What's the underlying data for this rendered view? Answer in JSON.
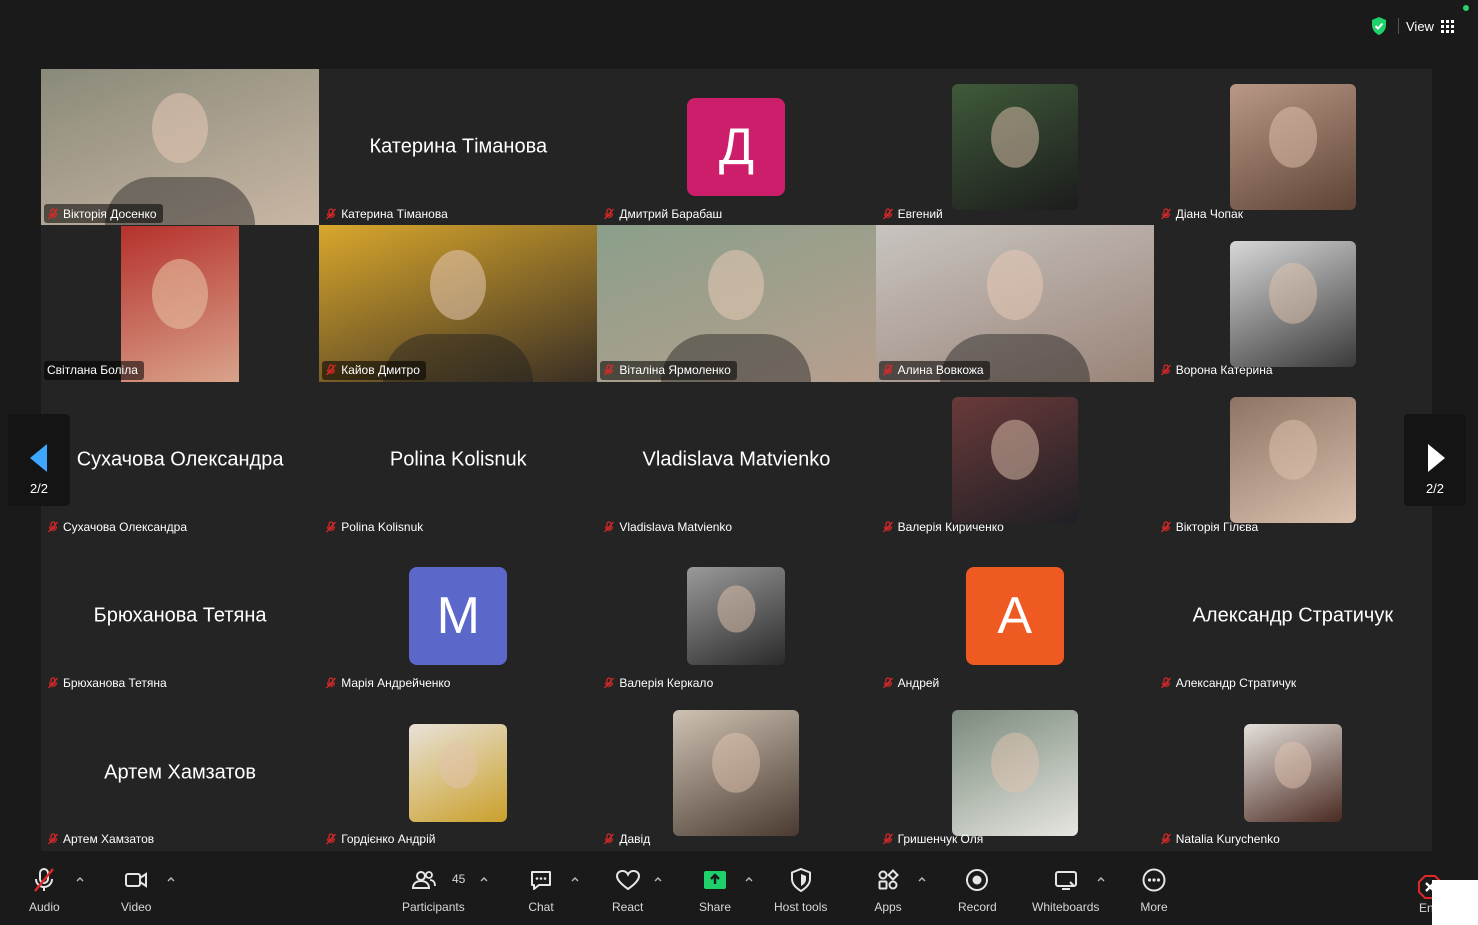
{
  "header": {
    "view_label": "View"
  },
  "gallery": {
    "tiles": [
      {
        "name": "Вікторія Досенко",
        "kind": "video",
        "c1": "#8a8a7a",
        "c2": "#c9b6a4",
        "muted": true
      },
      {
        "name": "Катерина Тіманова",
        "kind": "name",
        "display": "Катерина Тіманова",
        "muted": true
      },
      {
        "name": "Дмитрий Барабаш",
        "kind": "avatar",
        "letter": "Д",
        "color": "#cc1e6a",
        "muted": true
      },
      {
        "name": "Евгений",
        "kind": "photo",
        "c1": "#3f5a3a",
        "c2": "#1c1c1c",
        "muted": true
      },
      {
        "name": "Діана Чопак",
        "kind": "photo",
        "c1": "#b99886",
        "c2": "#5e4436",
        "muted": true
      },
      {
        "name": "Світлана Боліла",
        "kind": "photo-wide",
        "c1": "#b5312c",
        "c2": "#d9a38b",
        "muted": false
      },
      {
        "name": "Кайов Дмитро",
        "kind": "video",
        "c1": "#d9a72c",
        "c2": "#3a2f24",
        "muted": true
      },
      {
        "name": "Віталіна Ярмоленко",
        "kind": "video",
        "c1": "#8a9f8a",
        "c2": "#b79f8f",
        "muted": true
      },
      {
        "name": "Алина Вовкожа",
        "kind": "video",
        "c1": "#c8c4c0",
        "c2": "#9a8478",
        "muted": true
      },
      {
        "name": "Ворона Катерина",
        "kind": "photo",
        "c1": "#d8d8d8",
        "c2": "#3a3a3a",
        "muted": true
      },
      {
        "name": "Сухачова Олександра",
        "kind": "name",
        "display": "Сухачова Олександра",
        "muted": true
      },
      {
        "name": "Polina Kolisnuk",
        "kind": "name",
        "display": "Polina Kolisnuk",
        "muted": true
      },
      {
        "name": "Vladislava Matvienko",
        "kind": "name",
        "display": "Vladislava Matvienko",
        "muted": true
      },
      {
        "name": "Валерія Кириченко",
        "kind": "photo",
        "c1": "#6a3a3a",
        "c2": "#1f1f24",
        "muted": true
      },
      {
        "name": "Вікторія Гілєва",
        "kind": "photo",
        "c1": "#8d7464",
        "c2": "#d9c0ad",
        "muted": true
      },
      {
        "name": "Брюханова Тетяна",
        "kind": "name",
        "display": "Брюханова Тетяна",
        "muted": true
      },
      {
        "name": "Марія Андрейченко",
        "kind": "avatar",
        "letter": "M",
        "color": "#5b67c9",
        "muted": true
      },
      {
        "name": "Валерія Керкало",
        "kind": "photo-sm",
        "c1": "#9a9a9a",
        "c2": "#2a2a2a",
        "muted": true
      },
      {
        "name": "Андрей",
        "kind": "avatar",
        "letter": "А",
        "color": "#ef5a22",
        "muted": true
      },
      {
        "name": "Александр Стратичук",
        "kind": "name",
        "display": "Александр Стратичук",
        "muted": true
      },
      {
        "name": "Артем Хамзатов",
        "kind": "name",
        "display": "Артем Хамзатов",
        "muted": true
      },
      {
        "name": "Гордієнко Андрій",
        "kind": "photo-sm",
        "c1": "#e8e2d8",
        "c2": "#caa02a",
        "muted": true
      },
      {
        "name": "Давід",
        "kind": "photo",
        "c1": "#cfc2b4",
        "c2": "#4a3a30",
        "muted": true
      },
      {
        "name": "Гришенчук Оля",
        "kind": "photo",
        "c1": "#7a8a7c",
        "c2": "#e6e6e0",
        "muted": true
      },
      {
        "name": "Natalia Kurychenko",
        "kind": "photo-sm",
        "c1": "#e4e0da",
        "c2": "#4a2a22",
        "muted": true
      }
    ],
    "pager_left": "2/2",
    "pager_right": "2/2"
  },
  "toolbar": {
    "audio": "Audio",
    "video": "Video",
    "participants": "Participants",
    "participants_count": "45",
    "chat": "Chat",
    "react": "React",
    "share": "Share",
    "host_tools": "Host tools",
    "apps": "Apps",
    "record": "Record",
    "whiteboards": "Whiteboards",
    "more": "More",
    "end": "En"
  },
  "colors": {
    "share_green": "#1fd16a",
    "end_red": "#e02828",
    "mic_off_red": "#e02828",
    "pager_blue": "#3da7ff"
  }
}
